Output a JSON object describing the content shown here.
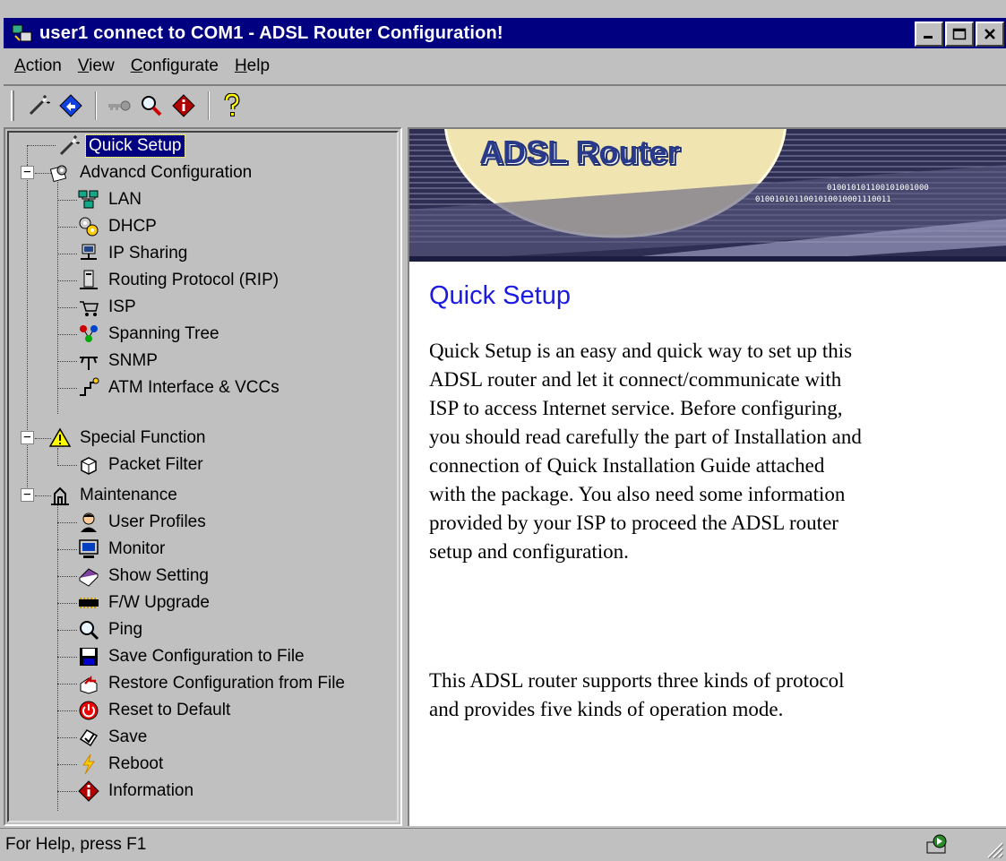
{
  "window": {
    "title": "user1 connect to COM1 - ADSL Router Configuration!"
  },
  "menu": {
    "items": [
      {
        "label": "Action",
        "accel": "A",
        "rest": "ction"
      },
      {
        "label": "View",
        "accel": "V",
        "rest": "iew"
      },
      {
        "label": "Configurate",
        "accel": "C",
        "rest": "onfigurate"
      },
      {
        "label": "Help",
        "accel": "H",
        "rest": "elp"
      }
    ]
  },
  "toolbar": {
    "buttons": [
      "wizard-icon",
      "connect-icon",
      "keys-icon",
      "magnifier-icon",
      "info-icon",
      "help-icon"
    ]
  },
  "tree": {
    "items": [
      {
        "label": "Quick Setup",
        "icon": "wand-icon",
        "selected": true
      },
      {
        "label": "Advancd Configuration",
        "icon": "config-icon"
      },
      {
        "label": "LAN",
        "icon": "lan-icon"
      },
      {
        "label": "DHCP",
        "icon": "dhcp-icon"
      },
      {
        "label": "IP Sharing",
        "icon": "ip-sharing-icon"
      },
      {
        "label": "Routing Protocol (RIP)",
        "icon": "routing-icon"
      },
      {
        "label": "ISP",
        "icon": "isp-icon"
      },
      {
        "label": "Spanning Tree",
        "icon": "spanning-tree-icon"
      },
      {
        "label": "SNMP",
        "icon": "snmp-icon"
      },
      {
        "label": "ATM Interface & VCCs",
        "icon": "atm-icon"
      },
      {
        "label": "Special Function",
        "icon": "warning-icon"
      },
      {
        "label": "Packet Filter",
        "icon": "packet-filter-icon"
      },
      {
        "label": "Maintenance",
        "icon": "maintenance-icon"
      },
      {
        "label": "User Profiles",
        "icon": "user-profiles-icon"
      },
      {
        "label": "Monitor",
        "icon": "monitor-icon"
      },
      {
        "label": "Show Setting",
        "icon": "book-icon"
      },
      {
        "label": "F/W Upgrade",
        "icon": "chip-icon"
      },
      {
        "label": "Ping",
        "icon": "ping-icon"
      },
      {
        "label": "Save Configuration to File",
        "icon": "floppy-icon"
      },
      {
        "label": "Restore Configuration from File",
        "icon": "restore-icon"
      },
      {
        "label": "Reset to Default",
        "icon": "power-icon"
      },
      {
        "label": "Save",
        "icon": "save-icon"
      },
      {
        "label": "Reboot",
        "icon": "lightning-icon"
      },
      {
        "label": "Information",
        "icon": "info-icon"
      }
    ]
  },
  "content": {
    "banner_title": "ADSL Router",
    "banner_bits_1": "010010101100101001000",
    "banner_bits_2": "0100101011001010010001110011",
    "heading": "Quick Setup",
    "paragraph_lines": [
      "Quick Setup is an easy and quick way to set up this",
      "ADSL router and let it connect/communicate with",
      "ISP to access Internet service. Before configuring,",
      "you should read carefully the part of Installation and",
      "connection of Quick Installation Guide attached",
      "with the package. You also need some information",
      "provided by your ISP to proceed the ADSL router",
      "setup and configuration."
    ],
    "paragraph2_lines": [
      "This ADSL router supports three kinds of protocol",
      "and provides five kinds of operation mode."
    ]
  },
  "status": {
    "text": "For Help, press F1"
  },
  "colors": {
    "titlebar": "#000080",
    "face": "#c0c0c0",
    "heading": "#1a1ae0",
    "banner": "#33335a"
  }
}
